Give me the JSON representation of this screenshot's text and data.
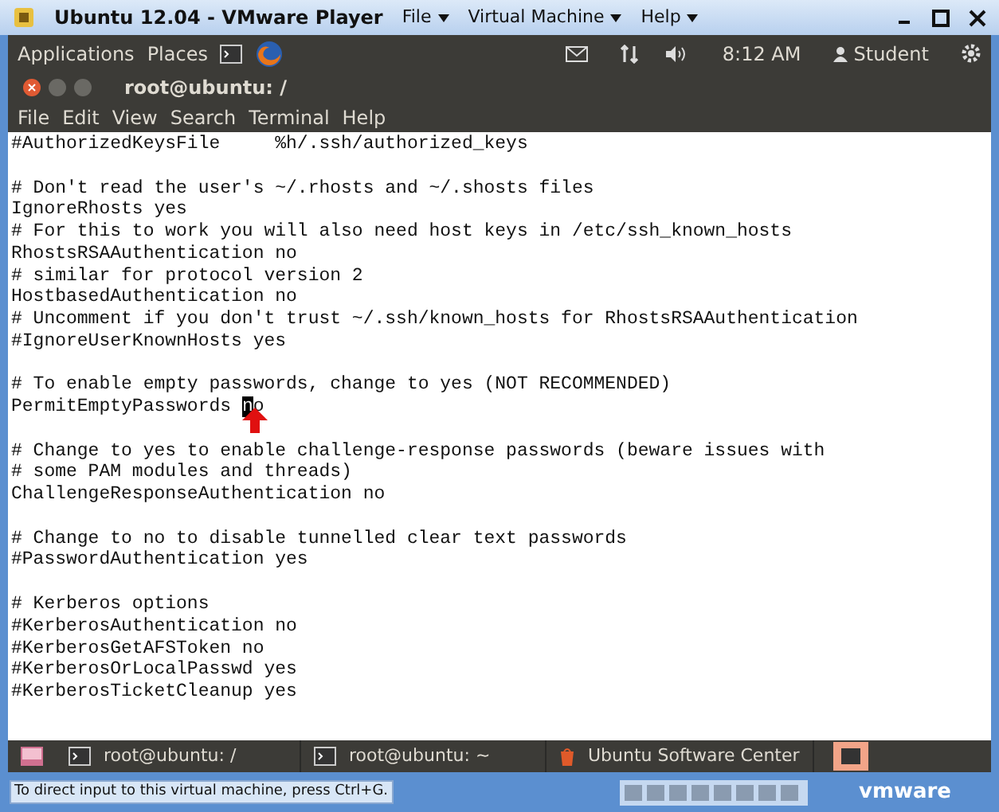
{
  "window": {
    "title": "Ubuntu 12.04 - VMware Player",
    "menus": [
      "File",
      "Virtual Machine",
      "Help"
    ]
  },
  "top_panel": {
    "menus": [
      "Applications",
      "Places"
    ],
    "clock": "8:12 AM",
    "user": "Student"
  },
  "terminal": {
    "title": "root@ubuntu: /",
    "menus": [
      "File",
      "Edit",
      "View",
      "Search",
      "Terminal",
      "Help"
    ],
    "lines": [
      {
        "kind": "text",
        "text": "#AuthorizedKeysFile     %h/.ssh/authorized_keys"
      },
      {
        "kind": "blank"
      },
      {
        "kind": "text",
        "text": "# Don't read the user's ~/.rhosts and ~/.shosts files"
      },
      {
        "kind": "text",
        "text": "IgnoreRhosts yes"
      },
      {
        "kind": "text",
        "text": "# For this to work you will also need host keys in /etc/ssh_known_hosts"
      },
      {
        "kind": "text",
        "text": "RhostsRSAAuthentication no"
      },
      {
        "kind": "text",
        "text": "# similar for protocol version 2"
      },
      {
        "kind": "text",
        "text": "HostbasedAuthentication no"
      },
      {
        "kind": "text",
        "text": "# Uncomment if you don't trust ~/.ssh/known_hosts for RhostsRSAAuthentication"
      },
      {
        "kind": "text",
        "text": "#IgnoreUserKnownHosts yes"
      },
      {
        "kind": "blank"
      },
      {
        "kind": "text",
        "text": "# To enable empty passwords, change to yes (NOT RECOMMENDED)"
      },
      {
        "kind": "cursor",
        "before": "PermitEmptyPasswords ",
        "at": "n",
        "after": "o"
      },
      {
        "kind": "blank"
      },
      {
        "kind": "text",
        "text": "# Change to yes to enable challenge-response passwords (beware issues with"
      },
      {
        "kind": "text",
        "text": "# some PAM modules and threads)"
      },
      {
        "kind": "text",
        "text": "ChallengeResponseAuthentication no"
      },
      {
        "kind": "blank"
      },
      {
        "kind": "text",
        "text": "# Change to no to disable tunnelled clear text passwords"
      },
      {
        "kind": "text",
        "text": "#PasswordAuthentication yes"
      },
      {
        "kind": "blank"
      },
      {
        "kind": "text",
        "text": "# Kerberos options"
      },
      {
        "kind": "text",
        "text": "#KerberosAuthentication no"
      },
      {
        "kind": "text",
        "text": "#KerberosGetAFSToken no"
      },
      {
        "kind": "text",
        "text": "#KerberosOrLocalPasswd yes"
      },
      {
        "kind": "text",
        "text": "#KerberosTicketCleanup yes"
      }
    ]
  },
  "taskbar": [
    {
      "label": "root@ubuntu: /",
      "kind": "terminal"
    },
    {
      "label": "root@ubuntu: ~",
      "kind": "terminal"
    },
    {
      "label": "Ubuntu Software Center",
      "kind": "software"
    }
  ],
  "status_bar": {
    "hint": "To direct input to this virtual machine, press Ctrl+G.",
    "logo": "vmware"
  }
}
